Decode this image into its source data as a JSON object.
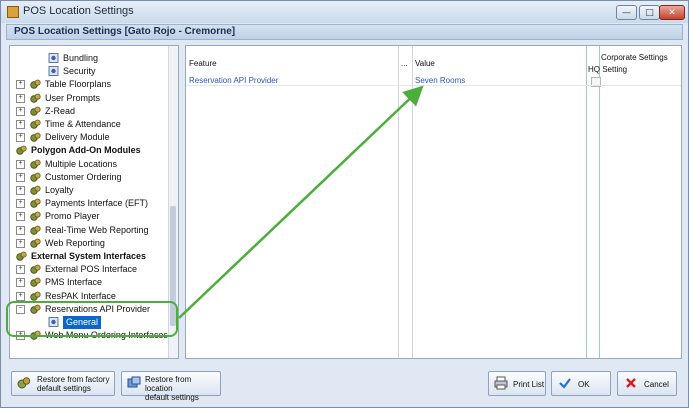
{
  "window": {
    "title": "POS Location Settings",
    "buttons": {
      "minimize": "—",
      "maximize": "□",
      "close": "✕"
    }
  },
  "header": {
    "title": "POS Location Settings  [Gato Rojo - Cremorne]"
  },
  "tree": {
    "items": [
      {
        "label": "Bundling",
        "level": 2,
        "icon": "gear-icon",
        "bold": false,
        "expander": "",
        "selected": false
      },
      {
        "label": "Security",
        "level": 2,
        "icon": "gear-icon",
        "bold": false,
        "expander": "",
        "selected": false
      },
      {
        "label": "Table Floorplans",
        "level": 1,
        "icon": "gears-icon",
        "bold": false,
        "expander": "+",
        "selected": false
      },
      {
        "label": "User Prompts",
        "level": 1,
        "icon": "gears-icon",
        "bold": false,
        "expander": "+",
        "selected": false
      },
      {
        "label": "Z-Read",
        "level": 1,
        "icon": "gears-icon",
        "bold": false,
        "expander": "+",
        "selected": false
      },
      {
        "label": "Time & Attendance",
        "level": 1,
        "icon": "gears-icon",
        "bold": false,
        "expander": "+",
        "selected": false
      },
      {
        "label": "Delivery Module",
        "level": 1,
        "icon": "gears-icon",
        "bold": false,
        "expander": "+",
        "selected": false
      },
      {
        "label": "Polygon Add-On Modules",
        "level": 0,
        "icon": "gears-icon",
        "bold": true,
        "expander": "",
        "selected": false
      },
      {
        "label": "Multiple Locations",
        "level": 1,
        "icon": "gears-icon",
        "bold": false,
        "expander": "+",
        "selected": false
      },
      {
        "label": "Customer Ordering",
        "level": 1,
        "icon": "gears-icon",
        "bold": false,
        "expander": "+",
        "selected": false
      },
      {
        "label": "Loyalty",
        "level": 1,
        "icon": "gears-icon",
        "bold": false,
        "expander": "+",
        "selected": false
      },
      {
        "label": "Payments Interface (EFT)",
        "level": 1,
        "icon": "gears-icon",
        "bold": false,
        "expander": "+",
        "selected": false
      },
      {
        "label": "Promo Player",
        "level": 1,
        "icon": "gears-icon",
        "bold": false,
        "expander": "+",
        "selected": false
      },
      {
        "label": "Real-Time Web Reporting",
        "level": 1,
        "icon": "gears-icon",
        "bold": false,
        "expander": "+",
        "selected": false
      },
      {
        "label": "Web Reporting",
        "level": 1,
        "icon": "gears-icon",
        "bold": false,
        "expander": "+",
        "selected": false
      },
      {
        "label": "External System Interfaces",
        "level": 0,
        "icon": "gears-icon",
        "bold": true,
        "expander": "",
        "selected": false
      },
      {
        "label": "External POS Interface",
        "level": 1,
        "icon": "gears-icon",
        "bold": false,
        "expander": "+",
        "selected": false
      },
      {
        "label": "PMS Interface",
        "level": 1,
        "icon": "gears-icon",
        "bold": false,
        "expander": "+",
        "selected": false
      },
      {
        "label": "ResPAK Interface",
        "level": 1,
        "icon": "gears-icon",
        "bold": false,
        "expander": "+",
        "selected": false
      },
      {
        "label": "Reservations API Provider",
        "level": 1,
        "icon": "gears-icon",
        "bold": false,
        "expander": "−",
        "selected": false
      },
      {
        "label": "General",
        "level": 2,
        "icon": "gear-icon",
        "bold": false,
        "expander": "",
        "selected": true
      },
      {
        "label": "Web Menu Ordering Interfaces",
        "level": 1,
        "icon": "gears-icon",
        "bold": false,
        "expander": "+",
        "selected": false
      }
    ]
  },
  "grid": {
    "corporate_header": "Corporate Settings",
    "columns": {
      "feature": "Feature",
      "dots": "...",
      "value": "Value",
      "hq": "HQ Setting"
    },
    "rows": [
      {
        "feature": "Reservation API Provider",
        "value": "Seven Rooms",
        "hq_checked": false
      }
    ]
  },
  "buttons": {
    "restore_factory": "Restore from factory\ndefault settings",
    "restore_location": "Restore from location\ndefault settings",
    "print_list": "Print List",
    "ok": "OK",
    "cancel": "Cancel"
  },
  "colors": {
    "selection": "#0a67c9",
    "link_text": "#2f55c5",
    "highlight_green": "#4cae3a",
    "ok_check": "#2a6fd6",
    "cancel_x": "#d21f1f"
  }
}
